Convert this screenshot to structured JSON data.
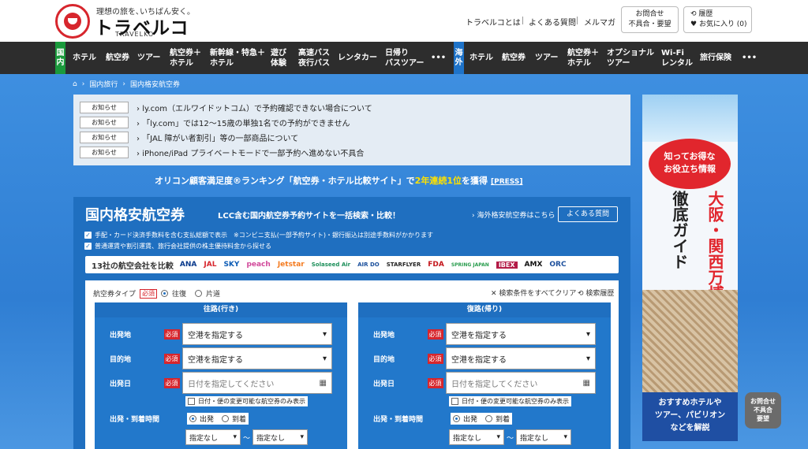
{
  "header": {
    "tagline": "理想の旅を､いちばん安く｡",
    "brand": "トラベルコ",
    "brand_sub": "TRAVELKO",
    "links": [
      "トラベルコとは",
      "よくある質問",
      "メルマガ"
    ],
    "contact_btn": [
      "お問合せ",
      "不具合・要望"
    ],
    "history_btn": [
      "履歴",
      "お気に入り (0)"
    ]
  },
  "nav": {
    "domestic_tag": [
      "国",
      "内"
    ],
    "domestic_items": [
      {
        "label": "ホテル"
      },
      {
        "label": "航空券"
      },
      {
        "label": "ツアー"
      },
      {
        "label": "航空券＋\nホテル"
      },
      {
        "label": "新幹線・特急＋\nホテル"
      },
      {
        "label": "遊び\n体験"
      },
      {
        "label": "高速バス\n夜行バス"
      },
      {
        "label": "レンタカー"
      },
      {
        "label": "日帰り\nバスツアー"
      },
      {
        "label": "•••"
      }
    ],
    "overseas_tag": [
      "海",
      "外"
    ],
    "overseas_items": [
      {
        "label": "ホテル"
      },
      {
        "label": "航空券"
      },
      {
        "label": "ツアー"
      },
      {
        "label": "航空券＋\nホテル"
      },
      {
        "label": "オプショナル\nツアー"
      },
      {
        "label": "Wi-Fi\nレンタル"
      },
      {
        "label": "旅行保険"
      },
      {
        "label": "•••"
      }
    ]
  },
  "breadcrumb": [
    "国内旅行",
    "国内格安航空券"
  ],
  "notices": {
    "label": "お知らせ",
    "items": [
      "ly.com（エルワイドットコム）で予約確認できない場合について",
      "「ly.com」では12～15歳の単独1名での予約ができません",
      "「JAL 障がい者割引」等の一部商品について",
      "iPhone/iPad プライベートモードで一部予約へ進めない不具合"
    ]
  },
  "oricon": {
    "text_pre": "オリコン顧客満足度®ランキング「航空券・ホテル比較サイト」で",
    "highlight": "2年連続1位",
    "text_post": "を獲得",
    "press": "[PRESS]"
  },
  "panel": {
    "title": "国内格安航空券",
    "subtitle": "LCC含む国内航空券予約サイトを一括検索・比較！",
    "overseas_link": "› 海外格安航空券はこちら",
    "faq_btn": "よくある質問",
    "checks": [
      "手配・カード決済手数料を含む支払総額で表示　※コンビニ支払(一部予約サイト)・銀行振込は別途手数料がかかります",
      "普通運賃や割引運賃、旅行会社提供の株主優待料金から探せる"
    ]
  },
  "airlines": {
    "label": "13社の航空会社を比較",
    "items": [
      {
        "name": "ANA",
        "color": "#0a3a8c"
      },
      {
        "name": "JAL",
        "color": "#d7262d"
      },
      {
        "name": "SKY",
        "color": "#0b5bb5"
      },
      {
        "name": "peach",
        "color": "#d1489a"
      },
      {
        "name": "Jetstar",
        "color": "#f47b20"
      },
      {
        "name": "Solaseed Air",
        "color": "#1c8f5a"
      },
      {
        "name": "AIR DO",
        "color": "#1a4f9c"
      },
      {
        "name": "STARFLYER",
        "color": "#222222"
      },
      {
        "name": "FDA",
        "color": "#c4161c"
      },
      {
        "name": "SPRING JAPAN",
        "color": "#2a9d4f"
      },
      {
        "name": "IBEX",
        "color": "#ffffff"
      },
      {
        "name": "AMX",
        "color": "#111111"
      },
      {
        "name": "ORC",
        "color": "#1c4f9c"
      }
    ]
  },
  "form": {
    "type_label": "航空券タイプ",
    "required": "必須",
    "round_trip": "往復",
    "one_way": "片道",
    "clear_all": "✕ 検索条件をすべてクリア",
    "history": "検索履歴",
    "outbound": {
      "head": "往路(行き)",
      "from_label": "出発地",
      "from_value": "空港を指定する",
      "to_label": "目的地",
      "to_value": "空港を指定する",
      "date_label": "出発日",
      "date_placeholder": "日付を指定してください",
      "note": "日付・便の変更可能な航空券のみ表示",
      "time_label": "出発・到着時間",
      "depart": "出発",
      "arrive": "到着",
      "time_from": "指定なし",
      "time_to": "指定なし",
      "tilde": "〜"
    },
    "return": {
      "head": "復路(帰り)",
      "from_label": "出発地",
      "from_value": "空港を指定する",
      "to_label": "目的地",
      "to_value": "空港を指定する",
      "date_label": "出発日",
      "date_placeholder": "日付を指定してください",
      "note": "日付・便の変更可能な航空券のみ表示",
      "time_label": "出発・到着時間",
      "depart": "出発",
      "arrive": "到着",
      "time_from": "指定なし",
      "time_to": "指定なし",
      "tilde": "〜"
    }
  },
  "banner": {
    "bubble": [
      "知ってお得な",
      "お役立ち情報"
    ],
    "vertical_red": "大阪・関西万博",
    "vertical_black": "徹底ガイド",
    "bottom": [
      "おすすめホテルや",
      "ツアー、パビリオン",
      "などを解説"
    ]
  },
  "floating": [
    "お問合せ",
    "不具合",
    "要望"
  ]
}
